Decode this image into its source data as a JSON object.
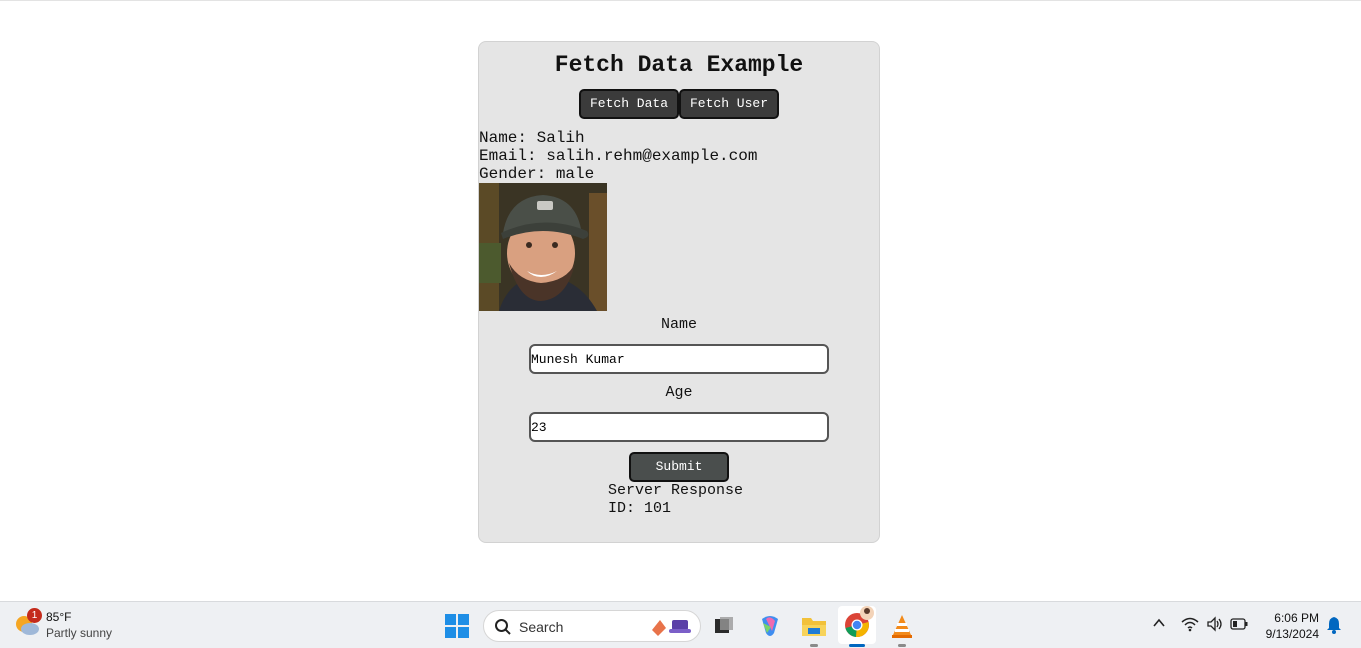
{
  "app": {
    "title": "Fetch Data Example",
    "buttons": {
      "fetch_data": "Fetch Data",
      "fetch_user": "Fetch User"
    }
  },
  "user": {
    "name_line": "Name: Salih",
    "email_line": "Email: salih.rehm@example.com",
    "gender_line": "Gender: male"
  },
  "form": {
    "name_label": "Name",
    "name_value": "Munesh Kumar",
    "age_label": "Age",
    "age_value": "23",
    "submit_label": "Submit"
  },
  "response": {
    "heading": "Server Response",
    "id_line": "ID: 101"
  },
  "taskbar": {
    "weather_temp": "85°F",
    "weather_desc": "Partly sunny",
    "weather_badge": "1",
    "search_placeholder": "Search",
    "time": "6:06 PM",
    "date": "9/13/2024",
    "accent": "#0067c0"
  }
}
